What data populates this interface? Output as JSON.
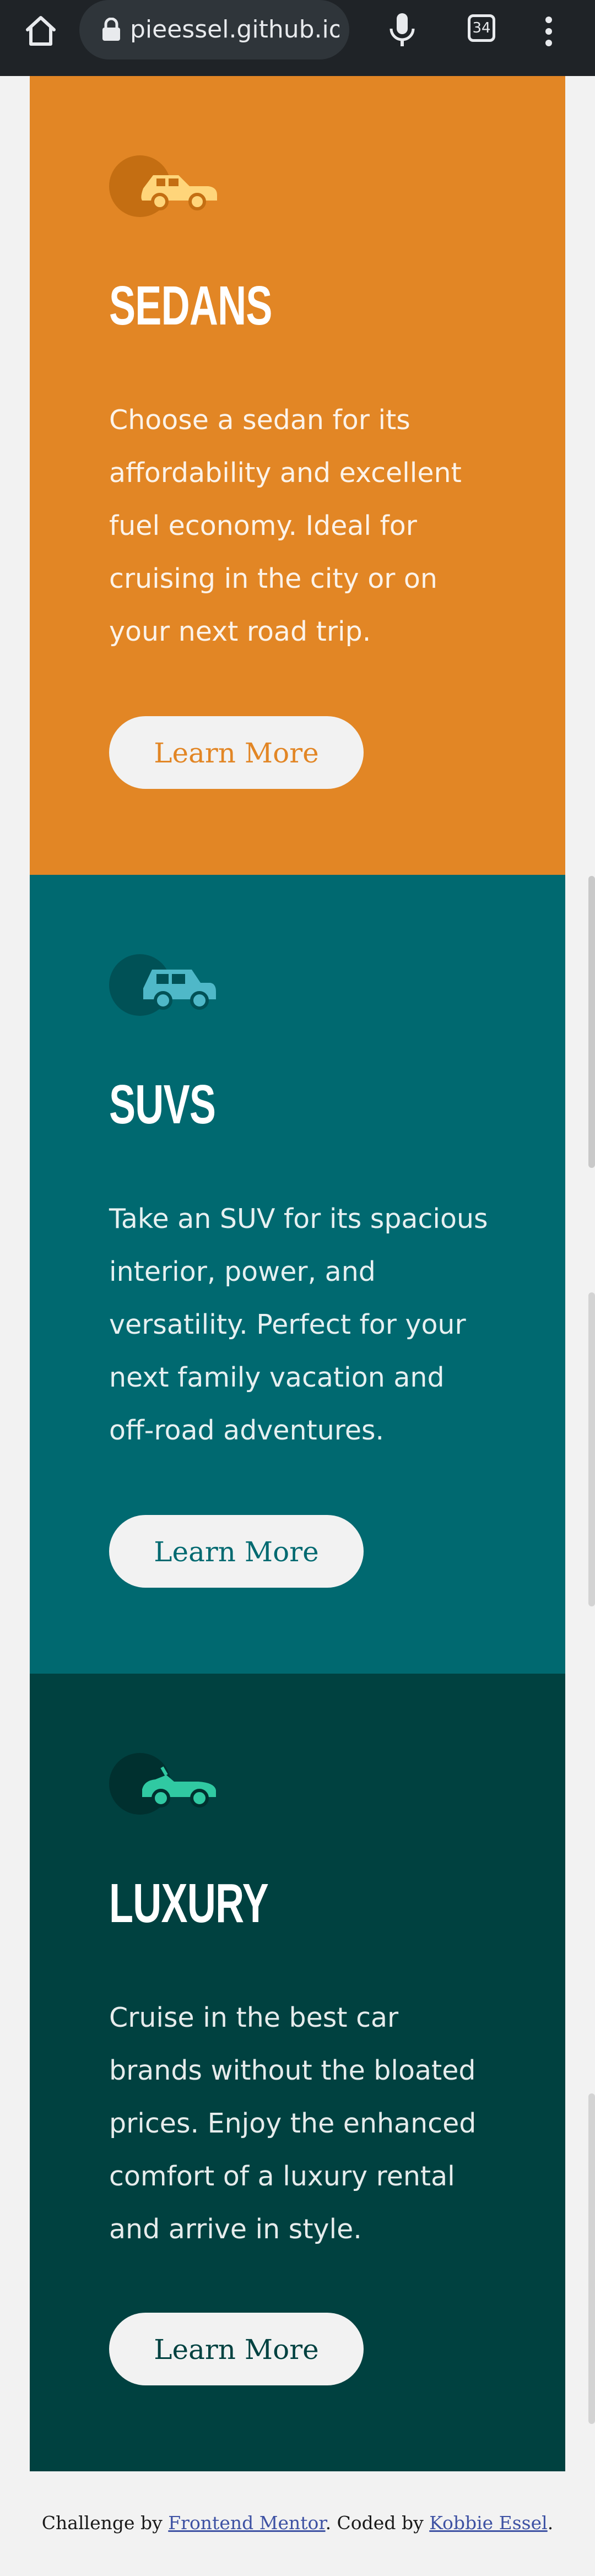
{
  "browser": {
    "url": "pieessel.github.io",
    "tab_count": "34"
  },
  "cards": [
    {
      "id": "sedans",
      "icon": "sedan-car-icon",
      "title": "SEDANS",
      "text": "Choose a sedan for its affordability and excellent fuel economy. Ideal for cruising in the city or on your next road trip.",
      "button": "Learn More",
      "color": "#e28625"
    },
    {
      "id": "suvs",
      "icon": "suv-car-icon",
      "title": "SUVS",
      "text": "Take an SUV for its spacious interior, power, and versatility. Perfect for your next family vacation and off-road adventures.",
      "button": "Learn More",
      "color": "#006970"
    },
    {
      "id": "luxury",
      "icon": "luxury-car-icon",
      "title": "LUXURY",
      "text": "Cruise in the best car brands without the bloated prices. Enjoy the enhanced comfort of a luxury rental and arrive in style.",
      "button": "Learn More",
      "color": "#004140"
    }
  ],
  "footer": {
    "prefix": "Challenge by ",
    "link1": "Frontend Mentor",
    "middle": ". Coded by ",
    "link2": "Kobbie Essel",
    "suffix": "."
  }
}
